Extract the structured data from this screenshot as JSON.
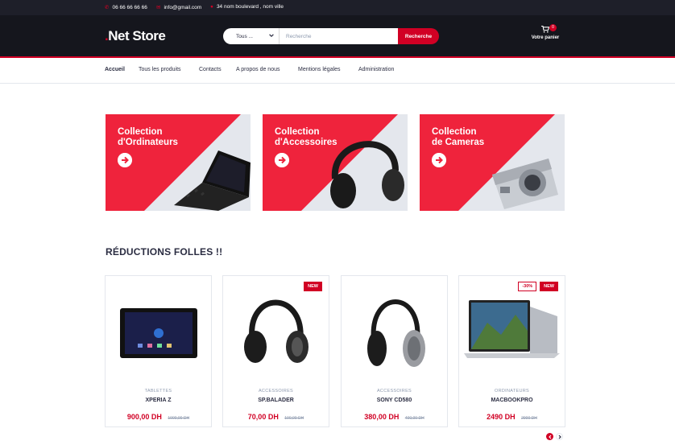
{
  "topbar": {
    "phone": "06 66 66 66 66",
    "email": "info@gmail.com",
    "address": "34 nom boulevard , nom ville"
  },
  "header": {
    "logo_dot": ".",
    "logo_text": "Net Store",
    "search_category": "Tous ...",
    "search_placeholder": "Recherche",
    "search_button": "Recherche",
    "cart_label": "Votre panier",
    "cart_count": "0"
  },
  "nav": {
    "items": [
      "Accueil",
      "Tous les produits",
      "Contacts",
      "A propos de nous",
      "Mentions légales",
      "Administration"
    ]
  },
  "collections": [
    {
      "line1": "Collection",
      "line2": "d'Ordinateurs",
      "icon": "laptop-image"
    },
    {
      "line1": "Collection",
      "line2": "d'Accessoires",
      "icon": "headphones-image"
    },
    {
      "line1": "Collection",
      "line2": "de Cameras",
      "icon": "camera-image"
    }
  ],
  "section": {
    "title": "RÉDUCTIONS FOLLES !!"
  },
  "products": [
    {
      "category": "TABLETTES",
      "name": "XPERIA Z",
      "price": "900,00 DH",
      "old_price": "1000,00 DH",
      "badges": []
    },
    {
      "category": "ACCESSOIRES",
      "name": "SP.BALADER",
      "price": "70,00 DH",
      "old_price": "100,00 DH",
      "badges": [
        "NEW"
      ]
    },
    {
      "category": "ACCESSOIRES",
      "name": "SONY CD580",
      "price": "380,00 DH",
      "old_price": "400,00 DH",
      "badges": []
    },
    {
      "category": "ORDINATEURS",
      "name": "MACBOOKPRO",
      "price": "2490 DH",
      "old_price": "2900 DH",
      "badges": [
        "-30%",
        "NEW"
      ]
    }
  ],
  "colors": {
    "accent": "#d10024",
    "dark": "#15161d",
    "topbar": "#1e1f29",
    "text": "#2b2d42",
    "muted": "#8d99ae"
  }
}
